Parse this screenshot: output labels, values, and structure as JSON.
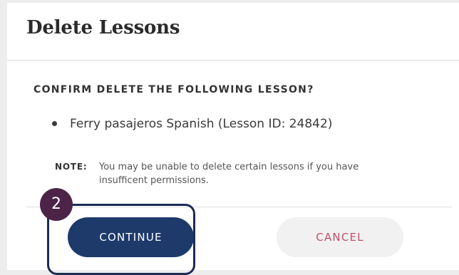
{
  "dialog": {
    "title": "Delete Lessons",
    "confirm_heading": "CONFIRM DELETE THE FOLLOWING LESSON?",
    "lessons": [
      {
        "label": "Ferry pasajeros Spanish (Lesson ID: 24842)"
      }
    ],
    "note": {
      "label": "NOTE:",
      "text": "You may be unable to delete certain lessons if you have insufficent permissions."
    },
    "buttons": {
      "continue_label": "CONTINUE",
      "cancel_label": "CANCEL"
    }
  },
  "overlay": {
    "step_number": "2"
  },
  "colors": {
    "continue_bg": "#1e3a6b",
    "cancel_text": "#c0506a",
    "step_badge": "#4b2448",
    "highlight_frame": "#1b2d55"
  }
}
